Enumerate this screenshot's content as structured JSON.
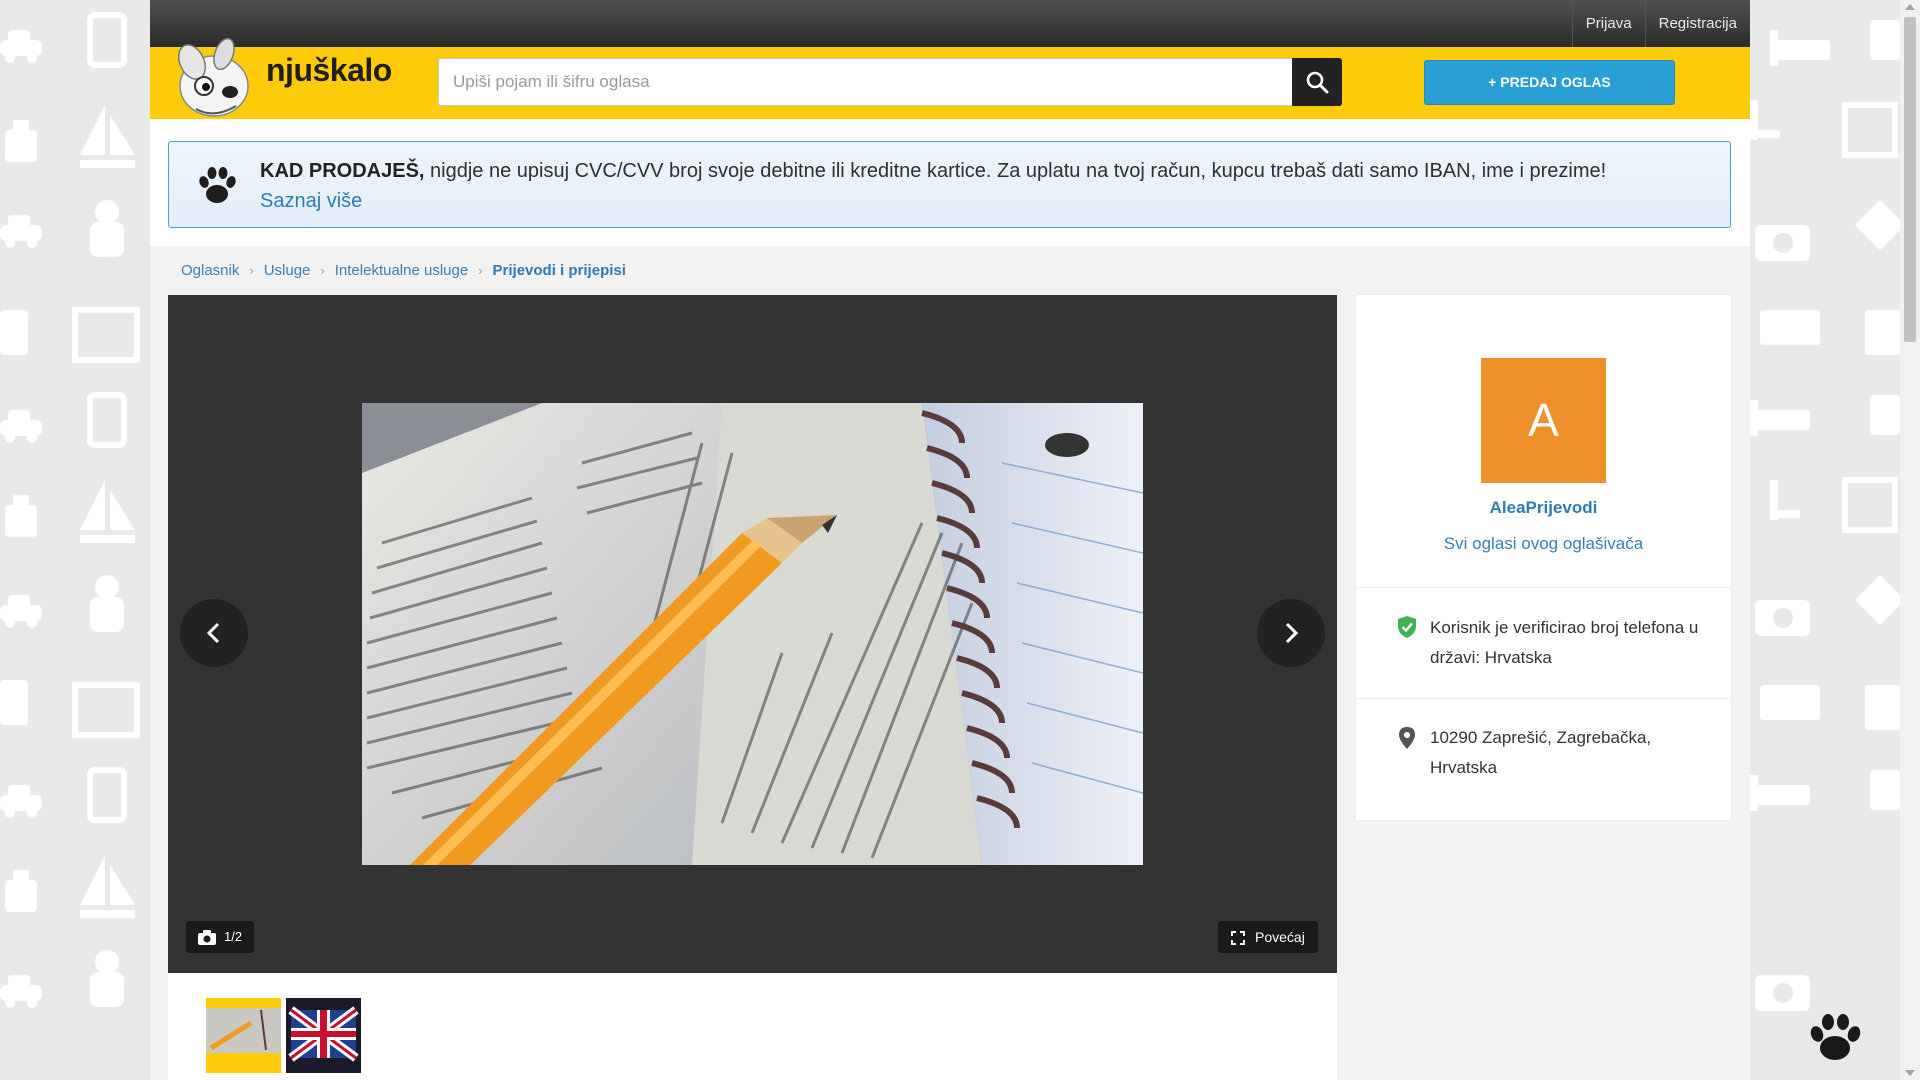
{
  "topbar": {
    "login": "Prijava",
    "register": "Registracija"
  },
  "header": {
    "logo_text": "njuškalo",
    "search_placeholder": "Upiši pojam ili šifru oglasa",
    "sell_button": "+ PREDAJ OGLAS"
  },
  "notice": {
    "bold": "KAD PRODAJEŠ,",
    "text": " nigdje ne upisuj CVC/CVV broj svoje debitne ili kreditne kartice. Za uplatu na tvoj račun, kupcu trebaš dati samo IBAN, ime i prezime!",
    "link": "Saznaj više"
  },
  "breadcrumb": {
    "items": [
      "Oglasnik",
      "Usluge",
      "Intelektualne usluge"
    ],
    "current": "Prijevodi i prijepisi"
  },
  "gallery": {
    "counter": "1/2",
    "enlarge": "Povećaj"
  },
  "seller": {
    "avatar_letter": "A",
    "avatar_color": "#f0902b",
    "name": "AleaPrijevodi",
    "all_ads": "Svi oglasi ovog oglašivača",
    "verified": "Korisnik je verificirao broj telefona u državi: Hrvatska",
    "location": "10290 Zaprešić, Zagrebačka, Hrvatska"
  },
  "colors": {
    "brand_yellow": "#fdcb09",
    "link_blue": "#2f79b4",
    "sell_blue": "#2a9fd6",
    "verified_green": "#3fb34f"
  }
}
